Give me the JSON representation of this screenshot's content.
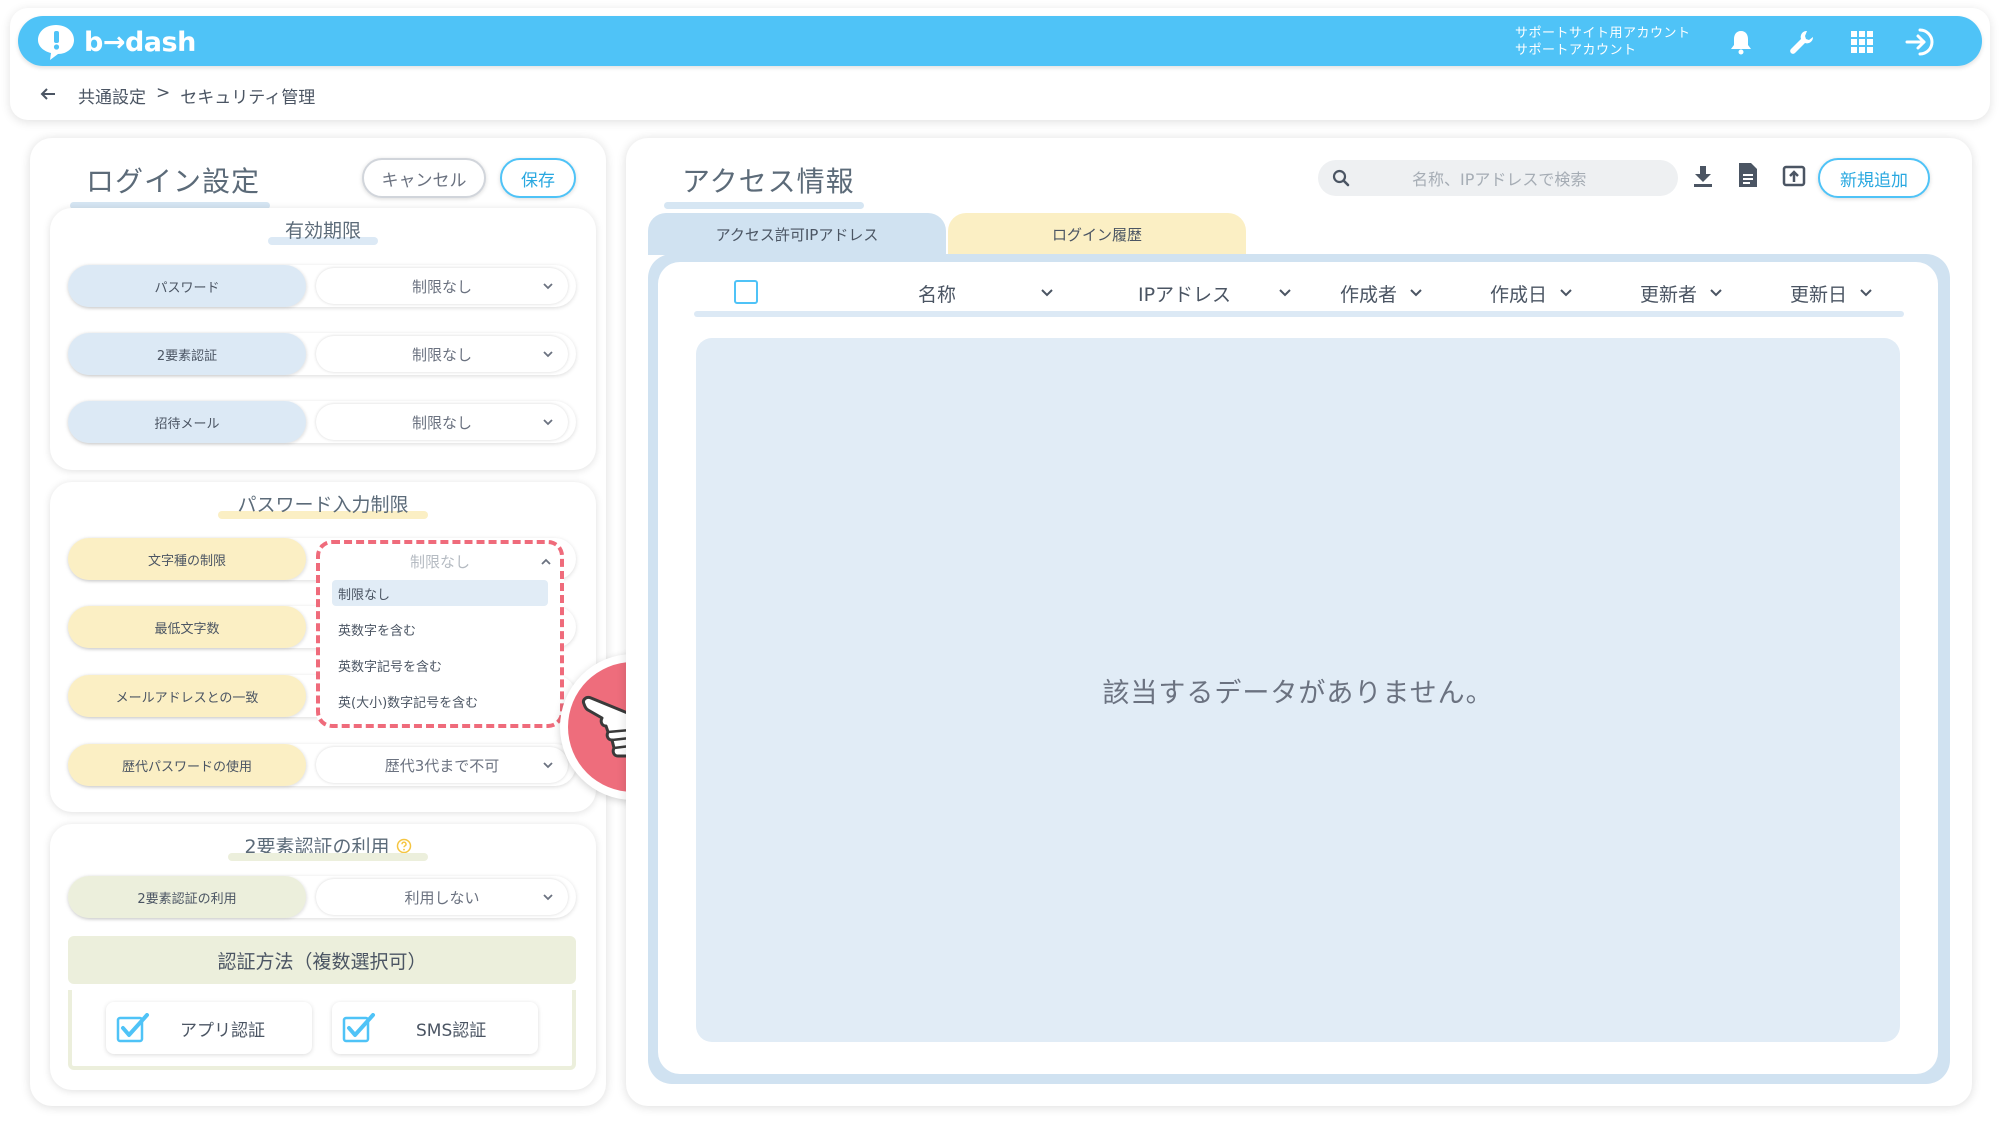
{
  "header": {
    "logo_text": "b→dash",
    "account_line1": "サポートサイト用アカウント",
    "account_line2": "サポートアカウント",
    "icons": [
      "bell-icon",
      "wrench-icon",
      "grid-icon",
      "logout-icon"
    ]
  },
  "breadcrumb": {
    "back_icon": "arrow-left-icon",
    "part1": "共通設定",
    "separator": ">",
    "part2": "セキュリティ管理"
  },
  "login_settings": {
    "title": "ログイン設定",
    "cancel_label": "キャンセル",
    "save_label": "保存",
    "expiry": {
      "title": "有効期限",
      "rows": [
        {
          "label": "パスワード",
          "value": "制限なし"
        },
        {
          "label": "2要素認証",
          "value": "制限なし"
        },
        {
          "label": "招待メール",
          "value": "制限なし"
        }
      ]
    },
    "password_rules": {
      "title": "パスワード入力制限",
      "rows": [
        {
          "label": "文字種の制限",
          "value": "制限なし"
        },
        {
          "label": "最低文字数",
          "value": ""
        },
        {
          "label": "メールアドレスとの一致",
          "value": ""
        },
        {
          "label": "歴代パスワードの使用",
          "value": "歴代3代まで不可"
        }
      ],
      "dropdown_options": [
        "制限なし",
        "英数字を含む",
        "英数字記号を含む",
        "英(大小)数字記号を含む"
      ],
      "dropdown_selected": "制限なし"
    },
    "two_factor": {
      "title": "2要素認証の利用",
      "help_icon": "question-circle-icon",
      "row": {
        "label": "2要素認証の利用",
        "value": "利用しない"
      },
      "methods_title": "認証方法（複数選択可）",
      "methods": [
        {
          "label": "アプリ認証",
          "checked": true
        },
        {
          "label": "SMS認証",
          "checked": true
        }
      ]
    }
  },
  "access_info": {
    "title": "アクセス情報",
    "search_placeholder": "名称、IPアドレスで検索",
    "new_button": "新規追加",
    "tabs": [
      "アクセス許可IPアドレス",
      "ログイン履歴"
    ],
    "columns": [
      "名称",
      "IPアドレス",
      "作成者",
      "作成日",
      "更新者",
      "更新日"
    ],
    "empty_message": "該当するデータがありません。"
  },
  "colors": {
    "brand": "#4fc3f7",
    "blue_label": "#dce9f5",
    "yellow_label": "#fbefc4",
    "olive_label": "#ecefdc",
    "highlight": "#ef6b7b"
  }
}
